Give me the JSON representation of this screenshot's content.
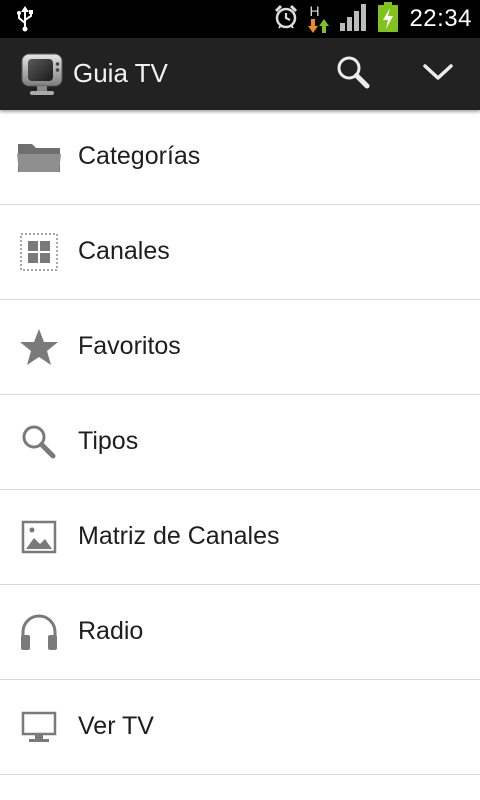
{
  "status_bar": {
    "time": "22:34",
    "network_type": "H",
    "icons": [
      "usb-icon",
      "alarm-icon",
      "network-activity-icon",
      "signal-icon",
      "battery-charging-icon"
    ]
  },
  "action_bar": {
    "title": "Guia TV",
    "logo_icon": "tv-logo-icon",
    "actions": [
      "search-icon",
      "chevron-down-icon"
    ]
  },
  "menu": {
    "items": [
      {
        "label": "Categorías",
        "icon": "folder-icon"
      },
      {
        "label": "Canales",
        "icon": "grid-icon"
      },
      {
        "label": "Favoritos",
        "icon": "star-icon"
      },
      {
        "label": "Tipos",
        "icon": "search-icon"
      },
      {
        "label": "Matriz de Canales",
        "icon": "image-icon"
      },
      {
        "label": "Radio",
        "icon": "headphones-icon"
      },
      {
        "label": "Ver TV",
        "icon": "monitor-icon"
      }
    ]
  },
  "colors": {
    "status_bar_bg": "#000000",
    "action_bar_bg": "#222222",
    "list_bg": "#ffffff",
    "divider": "#d9d9d9",
    "icon_gray": "#8a8a8a",
    "battery_green": "#7fc31c"
  }
}
